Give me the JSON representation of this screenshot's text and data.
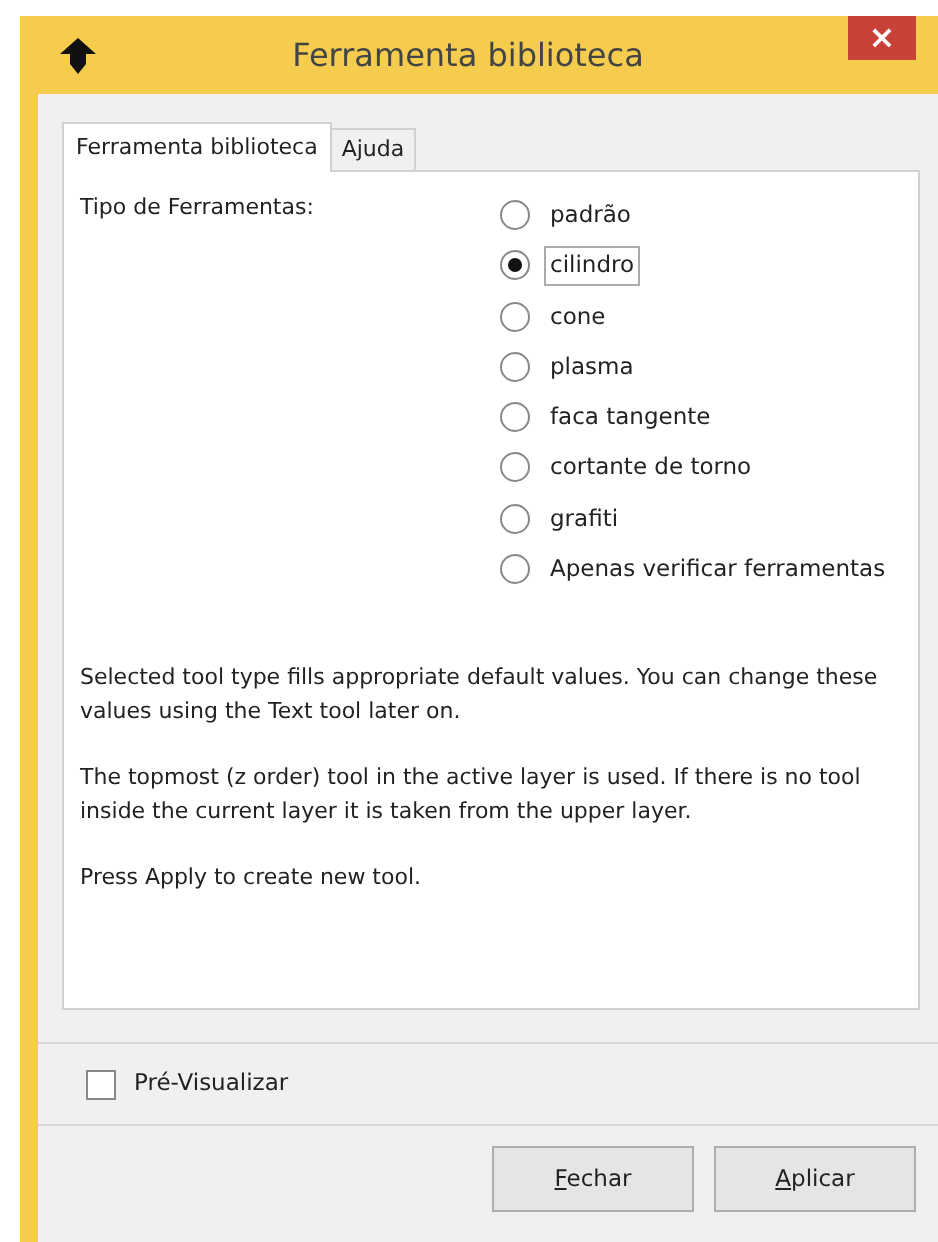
{
  "window": {
    "title": "Ferramenta biblioteca",
    "close": "×"
  },
  "tabs": [
    {
      "label": "Ferramenta biblioteca",
      "selected": true
    },
    {
      "label": "Ajuda",
      "selected": false
    }
  ],
  "tool_type": {
    "label": "Tipo de Ferramentas:",
    "options": [
      {
        "label": "padrão",
        "selected": false
      },
      {
        "label": "cilindro",
        "selected": true
      },
      {
        "label": "cone",
        "selected": false
      },
      {
        "label": "plasma",
        "selected": false
      },
      {
        "label": "faca tangente",
        "selected": false
      },
      {
        "label": "cortante de torno",
        "selected": false
      },
      {
        "label": "grafiti",
        "selected": false
      },
      {
        "label": "Apenas verificar ferramentas",
        "selected": false
      }
    ]
  },
  "notes": [
    "Selected tool type fills appropriate default values. You can change these values using the Text tool later on.",
    "The topmost (z order) tool in the active layer is used. If there is no tool inside the current layer it is taken from the upper layer.",
    "Press Apply to create new tool."
  ],
  "preview": {
    "label": "Pré-Visualizar",
    "checked": false
  },
  "buttons": [
    {
      "label": "Fechar",
      "underline_first": true
    },
    {
      "label": "Aplicar",
      "underline_first": true
    }
  ]
}
